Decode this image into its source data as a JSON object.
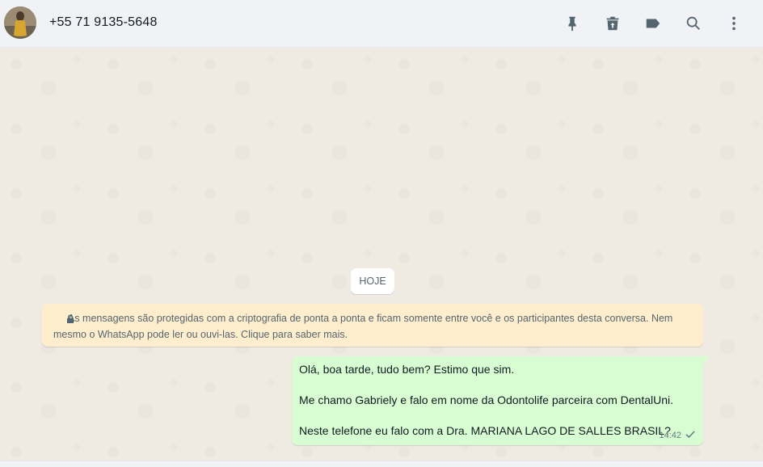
{
  "header": {
    "contact_name": "+55 71 9135-5648",
    "icons": [
      "pin-icon",
      "archive-icon",
      "label-icon",
      "search-icon",
      "menu-icon"
    ]
  },
  "chat": {
    "day_label": "HOJE",
    "encryption_notice": {
      "line1": "As mensagens são protegidas com a criptografia de ponta a ponta e ficam somente entre você e os participantes desta conversa. Nem",
      "line2": "mesmo o WhatsApp pode ler ou ouvi-las. Clique para saber mais."
    },
    "messages": [
      {
        "direction": "outgoing",
        "lines": [
          "Olá, boa tarde, tudo bem? Estimo que sim.",
          "Me chamo Gabriely e falo em nome da Odontolife parceira com DentalUni.",
          "Neste telefone eu falo com a Dra. MARIANA LAGO DE SALLES BRASIL?"
        ],
        "time": "14:42",
        "status": "sent"
      }
    ]
  },
  "colors": {
    "header_bg": "#f0f2f5",
    "chat_bg": "#efeae2",
    "outgoing_bubble": "#d9fdd3",
    "notice_bg": "#ffeecd",
    "icon": "#54656f"
  }
}
